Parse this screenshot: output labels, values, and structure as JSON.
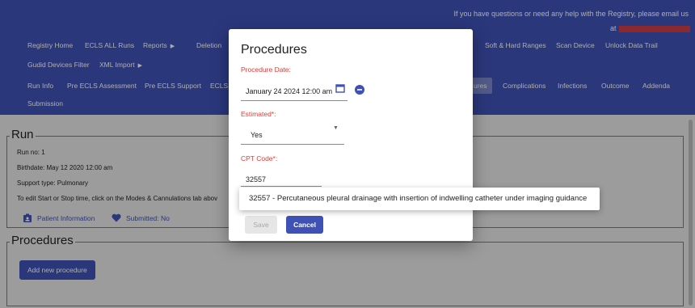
{
  "header": {
    "help_text": "If you have questions or need any help with the Registry, please email us",
    "help_at": "at",
    "nav_row1": {
      "registry_home": "Registry Home",
      "ecls_all_runs": "ECLS ALL Runs",
      "reports": "Reports",
      "deletion": "Deletion",
      "soft_hard_ranges": "Soft & Hard Ranges",
      "scan_device": "Scan Device",
      "unlock_data_trail": "Unlock Data Trail"
    },
    "nav_row2": {
      "gudid_devices_filter": "Gudid Devices Filter",
      "xml_import": "XML Import"
    },
    "nav_row3": {
      "run_info": "Run Info",
      "pre_ecls_assessment": "Pre ECLS Assessment",
      "pre_ecls_support": "Pre ECLS Support",
      "ecls_partial": "ECLS A",
      "procedures_partial": "ures",
      "complications": "Complications",
      "infections": "Infections",
      "outcome": "Outcome",
      "addenda": "Addenda"
    },
    "nav_row4": {
      "submission": "Submission"
    }
  },
  "run": {
    "legend": "Run",
    "run_no": "Run no: 1",
    "birthdate": "Birthdate: May 12 2020 12:00 am",
    "support_type": "Support type: Pulmonary",
    "edit_note": "To edit Start or Stop time, click on the Modes & Cannulations tab abov",
    "patient_information": "Patient Information",
    "submitted": "Submitted: No"
  },
  "procedures_section": {
    "legend": "Procedures",
    "add_button": "Add new procedure"
  },
  "modal": {
    "title": "Procedures",
    "date_label": "Procedure Date:",
    "date_value": "January 24 2024 12:00 am",
    "estimated_label": "Estimated*:",
    "estimated_value": "Yes",
    "cpt_label": "CPT Code*:",
    "cpt_value": "32557",
    "save": "Save",
    "cancel": "Cancel"
  },
  "autocomplete": {
    "option": "32557 - Percutaneous pleural drainage with insertion of indwelling catheter under imaging guidance"
  },
  "colors": {
    "brand": "#3f51b5",
    "required_label": "#e53935",
    "active_tab": "#7986cb"
  }
}
